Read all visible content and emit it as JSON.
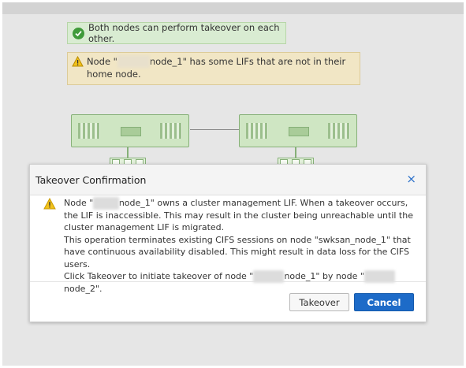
{
  "banners": {
    "success_text": "Both nodes can perform takeover on each other.",
    "warning_prefix": "Node \"",
    "warning_redacted": "xxxxxx",
    "warning_suffix": "node_1\" has some LIFs that are not in their home node."
  },
  "dialog": {
    "title": "Takeover Confirmation",
    "close_label": "×",
    "line1_prefix": "Node \"",
    "line1_redacted": "xxxxx",
    "line1_suffix": "node_1\" owns a cluster management LIF. When a takeover occurs, the LIF is inaccessible. This may result in the cluster being unreachable until the cluster management LIF is migrated.",
    "line2": "This operation terminates existing CIFS sessions on node \"swksan_node_1\" that have continuous availability disabled. This might result in data loss for the CIFS users.",
    "line3_prefix": "Click Takeover to initiate takeover of node \"",
    "line3_redacted_a": "xxxxxx",
    "line3_mid": "node_1\" by node \"",
    "line3_redacted_b": "xxxxxx",
    "line3_suffix": "node_2\".",
    "buttons": {
      "takeover": "Takeover",
      "cancel": "Cancel"
    }
  },
  "icons": {
    "success": "check-circle-icon",
    "warning": "warning-triangle-icon",
    "close": "close-icon"
  },
  "colors": {
    "success_green": "#3f9a3a",
    "warning_yellow": "#f2c21b",
    "primary_blue": "#1d6bc8"
  }
}
